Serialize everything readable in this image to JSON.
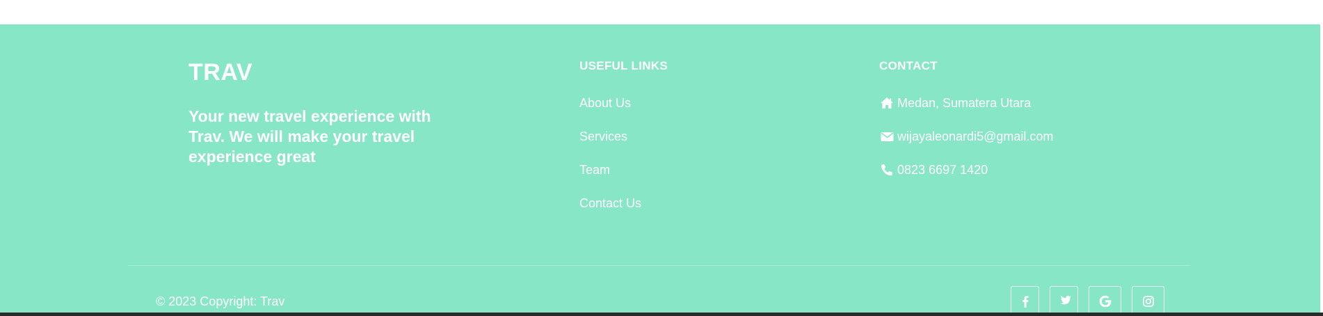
{
  "brand": {
    "name": "TRAV",
    "tagline": "Your new travel experience with Trav. We will make your travel experience great"
  },
  "useful_links": {
    "title": "USEFUL LINKS",
    "items": [
      {
        "label": "About Us"
      },
      {
        "label": "Services"
      },
      {
        "label": "Team"
      },
      {
        "label": "Contact Us"
      }
    ]
  },
  "contact": {
    "title": "CONTACT",
    "items": [
      {
        "icon": "home-icon",
        "text": "Medan, Sumatera Utara"
      },
      {
        "icon": "envelope-icon",
        "text": "wijayaleonardi5@gmail.com"
      },
      {
        "icon": "phone-icon",
        "text": "0823 6697 1420"
      }
    ]
  },
  "copyright": "© 2023 Copyright: Trav",
  "socials": [
    {
      "icon": "facebook-icon"
    },
    {
      "icon": "twitter-icon"
    },
    {
      "icon": "google-icon"
    },
    {
      "icon": "instagram-icon"
    }
  ],
  "colors": {
    "footer_bg": "#86e6c5",
    "text": "#ffffff"
  }
}
